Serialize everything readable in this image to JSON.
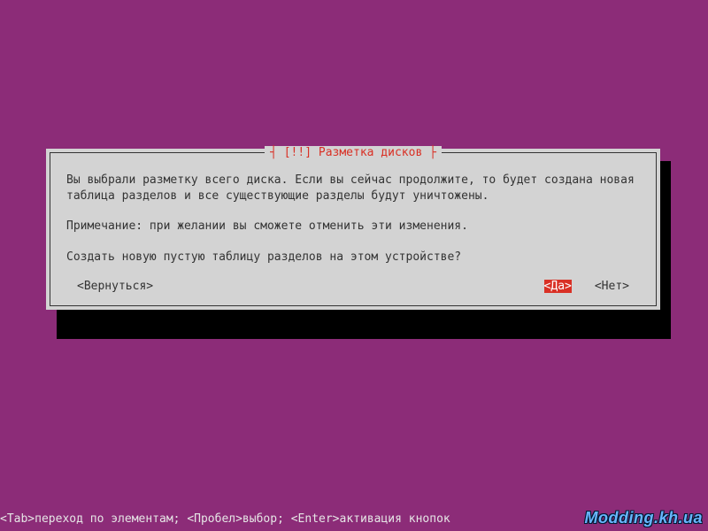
{
  "dialog": {
    "title_raw": "┤ [!!] Разметка дисков ├",
    "para1": "Вы выбрали разметку всего диска. Если вы сейчас продолжите, то будет создана новая таблица разделов и все существующие разделы будут уничтожены.",
    "para2": "Примечание: при желании вы сможете отменить эти изменения.",
    "para3": "Создать новую пустую таблицу разделов на этом устройстве?",
    "back_label": "<Вернуться>",
    "yes_label": "<Да>",
    "no_label": "<Нет>"
  },
  "hints": "<Tab>переход по элементам; <Пробел>выбор; <Enter>активация кнопок",
  "watermark": "Modding.kh.ua"
}
